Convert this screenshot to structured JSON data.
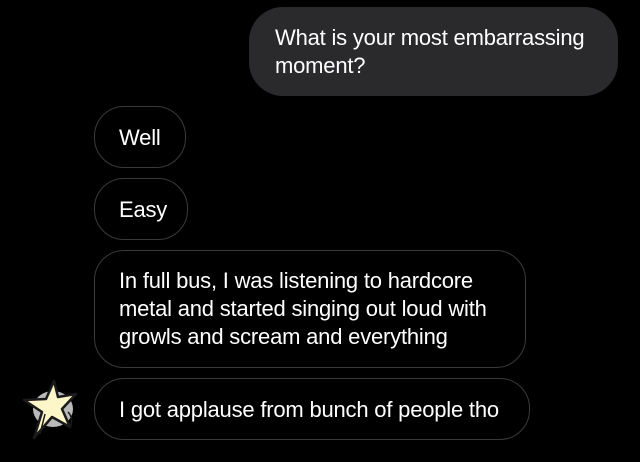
{
  "conversation": {
    "messages": [
      {
        "direction": "sent",
        "text": "What is your most embarrassing moment?"
      },
      {
        "direction": "received",
        "text": "Well"
      },
      {
        "direction": "received",
        "text": "Easy"
      },
      {
        "direction": "received",
        "text": "In full bus, I was listening to hardcore metal and started singing out loud with growls and scream and everything"
      },
      {
        "direction": "received",
        "text": "I got applause from bunch of people tho"
      }
    ],
    "sender_avatar_icon": "sparkle-star-sticker-icon"
  },
  "colors": {
    "background": "#000000",
    "sent_bubble": "#2a2a2c",
    "received_bubble_border": "#3a3a3c",
    "text": "#ffffff",
    "sticker_fill": "#fdf6c8"
  }
}
